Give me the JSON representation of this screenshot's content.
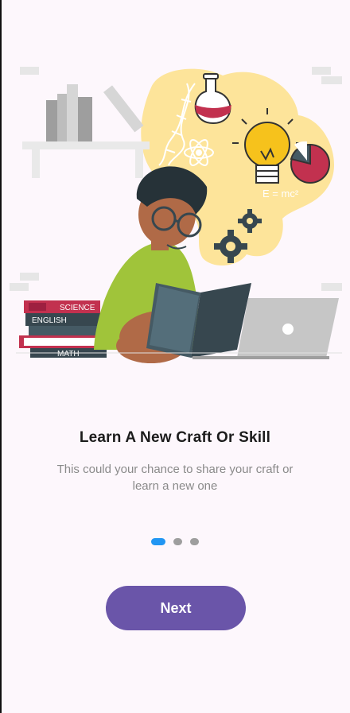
{
  "onboarding": {
    "title": "Learn A New Craft Or Skill",
    "subtitle": "This could your chance to share your craft or learn a new one",
    "page_indicator": {
      "total": 3,
      "active_index": 0
    },
    "next_label": "Next"
  },
  "illustration": {
    "books": [
      "SCIENCE",
      "ENGLISH",
      "",
      "MATH"
    ],
    "formula": "E = mc²"
  },
  "colors": {
    "background": "#fdf7fc",
    "accent": "#6a55a9",
    "indicator_active": "#2196f3",
    "indicator_inactive": "#9e9e9e"
  }
}
